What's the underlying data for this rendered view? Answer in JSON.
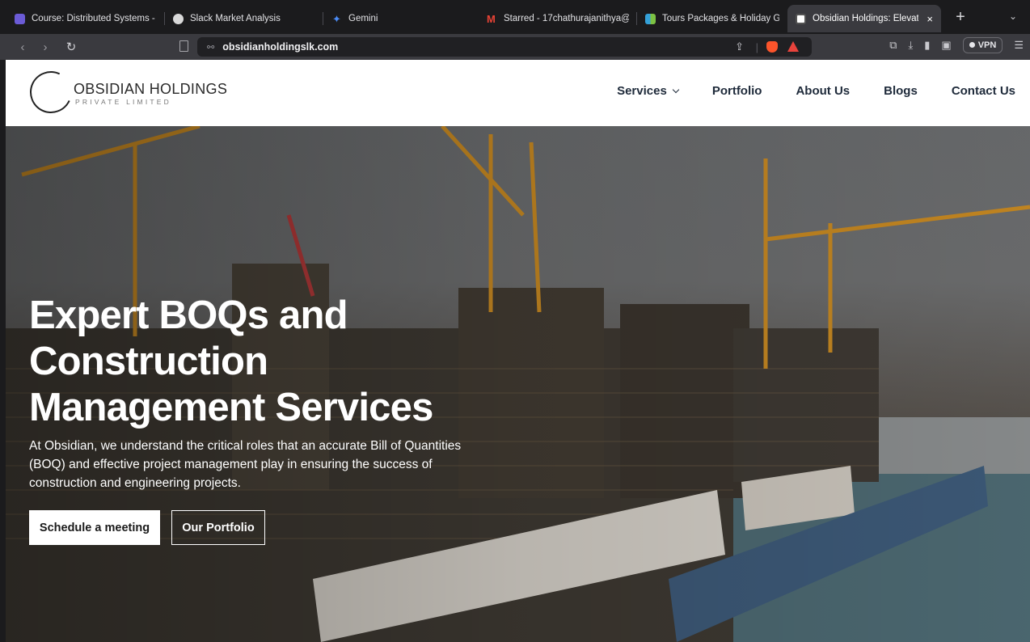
{
  "browser": {
    "tabs": [
      {
        "title": "Course: Distributed Systems -",
        "favicon_color": "#6b5bd6",
        "active": false
      },
      {
        "title": "Slack Market Analysis",
        "favicon_color": "#d9d9d9",
        "active": false
      },
      {
        "title": "Gemini",
        "favicon_color": "#4a8bf5",
        "active": false
      },
      {
        "title": "Starred - 17chathurajanithya@",
        "favicon_color": "#ea4335",
        "active": false
      },
      {
        "title": "Tours Packages & Holiday Gat",
        "favicon_color": "#34a0d8",
        "active": false
      },
      {
        "title": "Obsidian Holdings: Elevati",
        "favicon_color": "#ffffff",
        "active": true
      }
    ],
    "close_tab_icon": "×",
    "new_tab_icon": "+",
    "tab_menu_icon": "chevron-down-icon",
    "url": "obsidianholdingslk.com",
    "vpn_label": "VPN"
  },
  "site": {
    "logo": {
      "name": "OBSIDIAN HOLDINGS",
      "sub": "PRIVATE LIMITED"
    },
    "nav": {
      "services": "Services",
      "portfolio": "Portfolio",
      "about": "About Us",
      "blogs": "Blogs",
      "contact": "Contact Us"
    },
    "hero": {
      "heading": "Expert BOQs and Construction Management Services",
      "text": "At Obsidian, we understand the critical roles that an accurate Bill of Quantities (BOQ) and effective project management play in ensuring the success of construction and engineering projects.",
      "primary_button": "Schedule a meeting",
      "secondary_button": "Our Portfolio"
    }
  }
}
